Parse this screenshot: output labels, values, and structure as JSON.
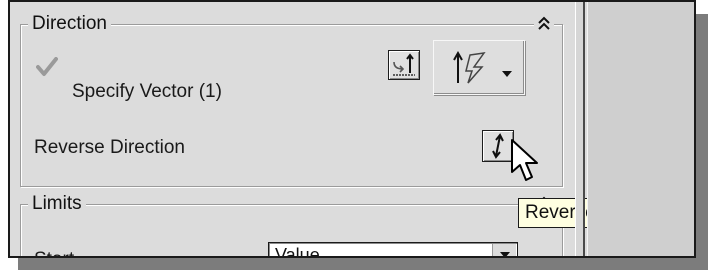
{
  "direction_group": {
    "title": "Direction",
    "collapse_icon": "double-chevron-up-icon",
    "specify_vector_label": "Specify Vector (1)",
    "reverse_direction_label": "Reverse Direction",
    "vector_type_icon": "inferred-vector-icon"
  },
  "limits_group": {
    "title": "Limits",
    "start_label": "Start",
    "start_value": "Value"
  },
  "tooltip": {
    "text": "Reverse Direction"
  },
  "colors": {
    "dialog_background": "#dcdcdc",
    "tooltip_background": "#ffffe1"
  }
}
